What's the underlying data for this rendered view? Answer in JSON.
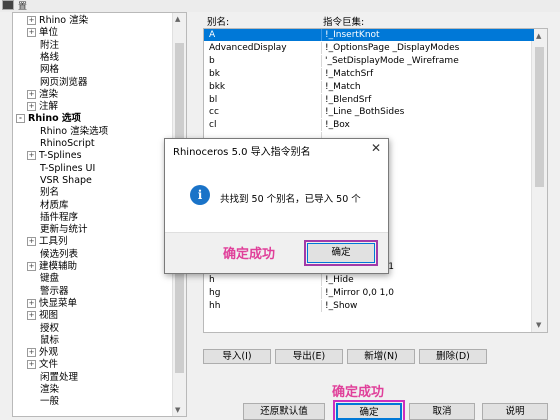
{
  "window": {
    "title_fragment": "置"
  },
  "tree": {
    "items": [
      {
        "label": "Rhino 渲染",
        "indent": 1,
        "expander": "+"
      },
      {
        "label": "单位",
        "indent": 1,
        "expander": "+"
      },
      {
        "label": "附注",
        "indent": 2,
        "expander": ""
      },
      {
        "label": "格线",
        "indent": 2,
        "expander": ""
      },
      {
        "label": "网格",
        "indent": 2,
        "expander": ""
      },
      {
        "label": "网页浏览器",
        "indent": 2,
        "expander": ""
      },
      {
        "label": "渲染",
        "indent": 1,
        "expander": "+"
      },
      {
        "label": "注解",
        "indent": 1,
        "expander": "+"
      },
      {
        "label": "Rhino 选项",
        "indent": 0,
        "expander": "-",
        "bold": true
      },
      {
        "label": "Rhino 渲染选项",
        "indent": 2,
        "expander": ""
      },
      {
        "label": "RhinoScript",
        "indent": 2,
        "expander": ""
      },
      {
        "label": "T-Splines",
        "indent": 1,
        "expander": "+"
      },
      {
        "label": "T-Splines UI",
        "indent": 2,
        "expander": ""
      },
      {
        "label": "VSR Shape",
        "indent": 2,
        "expander": ""
      },
      {
        "label": "别名",
        "indent": 2,
        "expander": ""
      },
      {
        "label": "材质库",
        "indent": 2,
        "expander": ""
      },
      {
        "label": "插件程序",
        "indent": 2,
        "expander": ""
      },
      {
        "label": "更新与统计",
        "indent": 2,
        "expander": ""
      },
      {
        "label": "工具列",
        "indent": 1,
        "expander": "+"
      },
      {
        "label": "候选列表",
        "indent": 2,
        "expander": ""
      },
      {
        "label": "建模辅助",
        "indent": 1,
        "expander": "+"
      },
      {
        "label": "键盘",
        "indent": 2,
        "expander": ""
      },
      {
        "label": "警示器",
        "indent": 2,
        "expander": ""
      },
      {
        "label": "快显菜单",
        "indent": 1,
        "expander": "+"
      },
      {
        "label": "视图",
        "indent": 1,
        "expander": "+"
      },
      {
        "label": "授权",
        "indent": 2,
        "expander": ""
      },
      {
        "label": "鼠标",
        "indent": 2,
        "expander": ""
      },
      {
        "label": "外观",
        "indent": 1,
        "expander": "+"
      },
      {
        "label": "文件",
        "indent": 1,
        "expander": "+"
      },
      {
        "label": "闲置处理",
        "indent": 2,
        "expander": ""
      },
      {
        "label": "渲染",
        "indent": 2,
        "expander": ""
      },
      {
        "label": "一般",
        "indent": 2,
        "expander": ""
      }
    ]
  },
  "alias_table": {
    "col_alias": "别名:",
    "col_macro": "指令巨集:",
    "rows": [
      {
        "alias": "A",
        "macro": "!_InsertKnot",
        "selected": true
      },
      {
        "alias": "AdvancedDisplay",
        "macro": "!_OptionsPage _DisplayModes"
      },
      {
        "alias": "b",
        "macro": "'_SetDisplayMode _Wireframe"
      },
      {
        "alias": "bk",
        "macro": "!_MatchSrf"
      },
      {
        "alias": "bkk",
        "macro": "!_Match"
      },
      {
        "alias": "bl",
        "macro": "!_BlendSrf"
      },
      {
        "alias": "cc",
        "macro": "!_Line _BothSides"
      },
      {
        "alias": "cl",
        "macro": "!_Box"
      },
      {
        "alias": "",
        "macro": ""
      },
      {
        "alias": "",
        "macro": ""
      },
      {
        "alias": "",
        "macro": ""
      },
      {
        "alias": "",
        "macro": ""
      },
      {
        "alias": "",
        "macro": ""
      },
      {
        "alias": "",
        "macro": ""
      },
      {
        "alias": "",
        "macro": ""
      },
      {
        "alias": "",
        "macro": ""
      },
      {
        "alias": "",
        "macro": ""
      },
      {
        "alias": "",
        "macro": ""
      },
      {
        "alias": "gh",
        "macro": "!_Mirror 0,0,0 1"
      },
      {
        "alias": "h",
        "macro": "!_Hide"
      },
      {
        "alias": "hg",
        "macro": "!_Mirror 0,0 1,0"
      },
      {
        "alias": "hh",
        "macro": "!_Show"
      }
    ]
  },
  "table_buttons": {
    "import": "导入(I)",
    "export": "导出(E)",
    "new": "新增(N)",
    "delete": "删除(D)"
  },
  "bottom_buttons": {
    "restore_defaults": "还原默认值",
    "ok": "确定",
    "cancel": "取消",
    "help": "说明"
  },
  "annotations": {
    "dialog_success": "确定成功",
    "bottom_success": "确定成功"
  },
  "dialog": {
    "title": "Rhinoceros 5.0  导入指令别名",
    "close": "✕",
    "icon_glyph": "i",
    "message": "共找到 50 个别名，已导入 50 个",
    "ok": "确定"
  },
  "colors": {
    "selection": "#0078d7",
    "annotation": "#e0409a",
    "highlight_box": "#cc2fbf"
  }
}
